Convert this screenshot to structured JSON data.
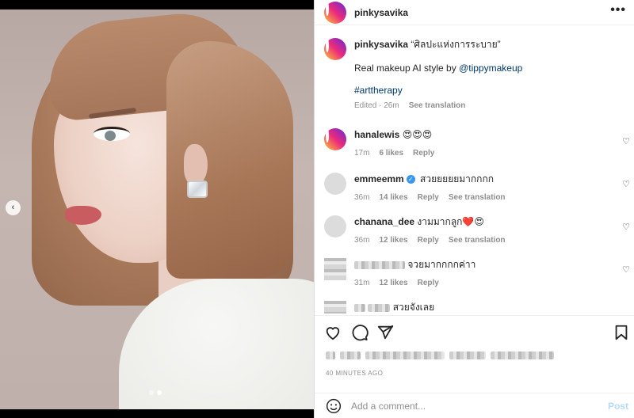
{
  "post": {
    "username": "pinkysavika",
    "more_label": "•••",
    "caption_title": "“ศิลปะแห่งการระบาย”",
    "caption_line": "Real makeup AI style by",
    "caption_mention": "@tippymakeup",
    "caption_hashtag": "#arttherapy",
    "caption_time": "Edited · 26m",
    "caption_translate": "See translation"
  },
  "comments": [
    {
      "username": "hanalewis",
      "text": "😍😍😍",
      "time": "17m",
      "likes": "6 likes",
      "reply": "Reply"
    },
    {
      "username": "emmeemm",
      "text": "สวยยยยยมากกกก",
      "time": "36m",
      "likes": "14 likes",
      "reply": "Reply",
      "translate": "See translation"
    },
    {
      "username": "chanana_dee",
      "text": "งามมากลูก❤️😍",
      "time": "36m",
      "likes": "12 likes",
      "reply": "Reply",
      "translate": "See translation"
    },
    {
      "username": "",
      "text": "จวยมากกกกค่าา",
      "time": "31m",
      "likes": "12 likes",
      "reply": "Reply"
    },
    {
      "username": "",
      "text": "สวยจังเลย"
    }
  ],
  "footer": {
    "timestamp": "40 MINUTES AGO",
    "comment_placeholder": "Add a comment...",
    "post_label": "Post"
  },
  "carousel": {
    "prev_icon": "‹",
    "slide_count": 2,
    "active_index": 1
  },
  "icons": [
    "heart-icon",
    "comment-icon",
    "share-icon",
    "bookmark-icon",
    "emoji-icon",
    "more-icon",
    "verified-icon"
  ],
  "colors": {
    "link": "#00376b",
    "muted": "#8e8e8e",
    "verified": "#3897f0",
    "post_button": "#b3dbff"
  }
}
